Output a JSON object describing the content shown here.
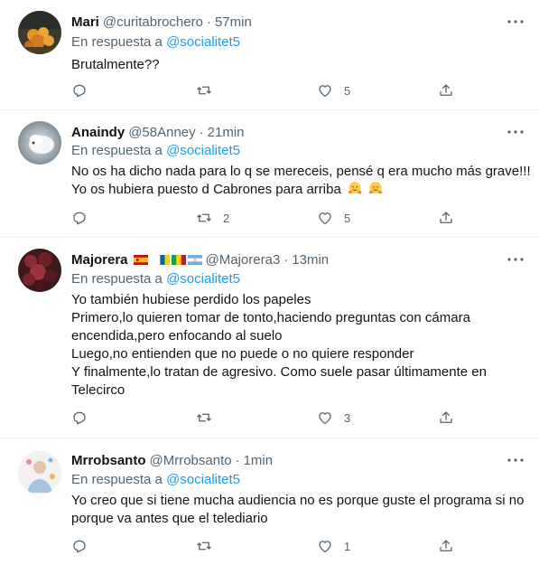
{
  "reply_prefix": "En respuesta a",
  "tweets": [
    {
      "name": "Mari",
      "handle": "@curitabrochero",
      "time": "57min",
      "mention": "@socialitet5",
      "lines": [
        "Brutalmente??"
      ],
      "replies": "",
      "retweets": "",
      "likes": "5"
    },
    {
      "name": "Anaindy",
      "handle": "@58Anney",
      "time": "21min",
      "mention": "@socialitet5",
      "lines": [
        "No os ha dicho nada para lo q se mereceis, pensé q era mucho más grave!!!",
        "Yo os hubiera puesto d Cabrones para arriba"
      ],
      "replies": "",
      "retweets": "2",
      "likes": "5"
    },
    {
      "name": "Majorera",
      "handle": "@Majorera3",
      "time": "13min",
      "mention": "@socialitet5",
      "lines": [
        "Yo también hubiese perdido los papeles",
        "Primero,lo quieren tomar de tonto,haciendo preguntas con cámara",
        "encendida,pero enfocando al suelo",
        "Luego,no entienden que no puede o no quiere responder",
        "Y finalmente,lo tratan de agresivo. Como suele pasar últimamente en",
        "Telecirco"
      ],
      "replies": "",
      "retweets": "",
      "likes": "3"
    },
    {
      "name": "Mrrobsanto",
      "handle": "@Mrrobsanto",
      "time": "1min",
      "mention": "@socialitet5",
      "lines": [
        "Yo creo que si tiene mucha audiencia no es porque guste el programa si no",
        "porque va antes que el telediario"
      ],
      "replies": "",
      "retweets": "",
      "likes": "1"
    }
  ],
  "icons": [
    "more-icon",
    "reply-icon",
    "retweet-icon",
    "like-icon",
    "share-icon",
    "hugging-face-emoji",
    "spain-flag",
    "canary-islands-flag",
    "argentina-flag"
  ],
  "colors": {
    "link": "#1d9bf0",
    "secondary": "#536471",
    "text": "#0f1419",
    "divider": "#eff3f4"
  }
}
